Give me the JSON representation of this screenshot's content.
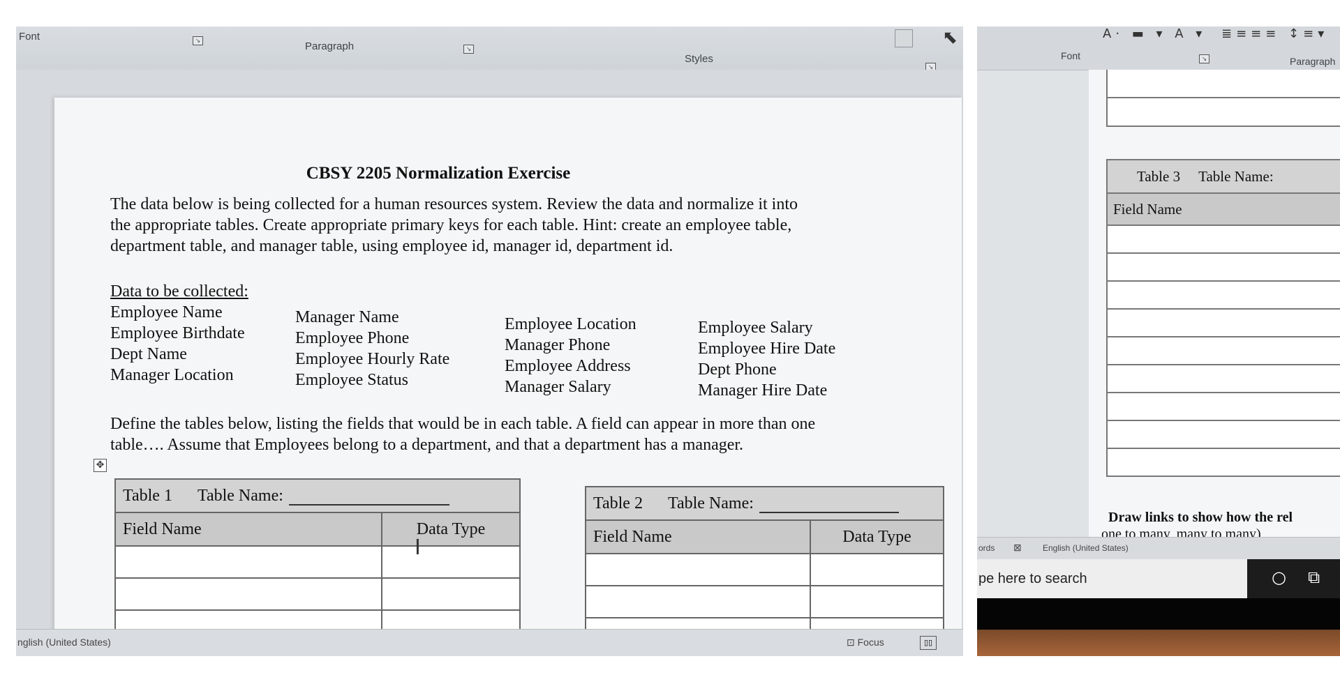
{
  "left": {
    "ribbon": {
      "font_label": "Font",
      "paragraph_label": "Paragraph",
      "styles_label": "Styles"
    },
    "document": {
      "title": "CBSY 2205 Normalization Exercise",
      "intro": "The data below is being collected for a human resources system. Review the data and normalize it into the appropriate tables.  Create appropriate primary keys for each table. Hint: create an employee table, department table, and manager table, using employee id, manager id, department id.",
      "data_heading": "Data to be collected:",
      "columns": [
        [
          "Employee Name",
          "Employee Birthdate",
          "Dept Name",
          "Manager Location"
        ],
        [
          "Manager Name",
          "Employee Phone",
          "Employee Hourly Rate",
          "Employee Status"
        ],
        [
          "Employee Location",
          "Manager Phone",
          "Employee Address",
          "Manager Salary"
        ],
        [
          "Employee Salary",
          "Employee Hire Date",
          "Dept Phone",
          "Manager Hire Date"
        ]
      ],
      "define_text": "Define the tables below, listing the fields that would be in each table. A field can appear in more than one table….  Assume that Employees belong to a department, and that a department has a manager.",
      "table1": {
        "label": "Table 1",
        "name_label": "Table Name:",
        "field_header": "Field Name",
        "type_header": "Data Type"
      },
      "table2": {
        "label": "Table 2",
        "name_label": "Table Name:",
        "field_header": "Field Name",
        "type_header": "Data Type"
      }
    },
    "status": {
      "language": "nglish (United States)",
      "focus": "Focus"
    }
  },
  "right": {
    "ribbon": {
      "font_label": "Font",
      "paragraph_label": "Paragraph"
    },
    "table3": {
      "label": "Table 3",
      "name_label": "Table Name:",
      "field_header": "Field Name"
    },
    "draw_links_line1": "Draw links to show how the rel",
    "draw_links_line2": "one to many, many to many)",
    "status": {
      "words": "ords",
      "language": "English (United States)"
    },
    "taskbar": {
      "search_text": "pe here to search"
    }
  }
}
